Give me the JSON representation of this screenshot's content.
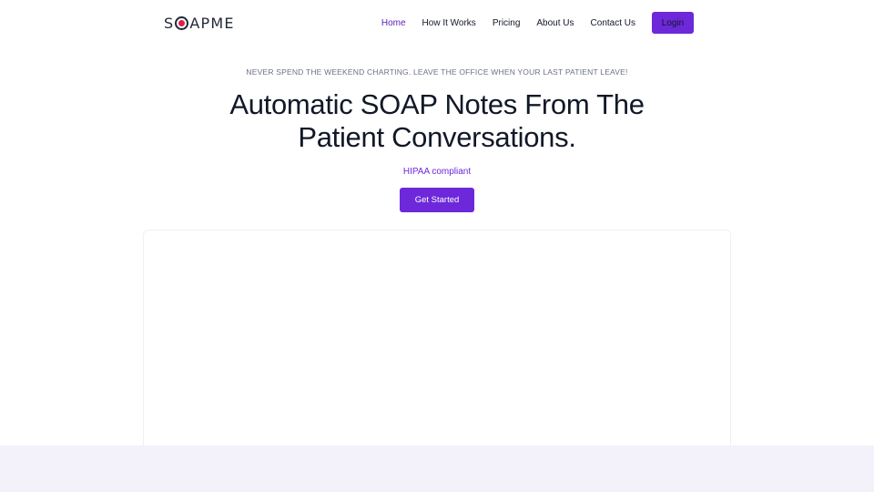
{
  "brand": {
    "name_prefix": "S",
    "name_suffix": "APME"
  },
  "nav": {
    "items": [
      {
        "label": "Home",
        "active": true
      },
      {
        "label": "How It Works"
      },
      {
        "label": "Pricing"
      },
      {
        "label": "About Us"
      },
      {
        "label": "Contact Us"
      }
    ],
    "login_label": "Login"
  },
  "hero": {
    "eyebrow": "NEVER SPEND THE WEEKEND CHARTING. LEAVE THE OFFICE WHEN YOUR LAST PATIENT LEAVE!",
    "headline_line1": "Automatic SOAP Notes From The",
    "headline_line2": "Patient Conversations.",
    "compliance": "HIPAA compliant",
    "cta_label": "Get Started"
  },
  "colors": {
    "accent": "#6d28d9",
    "logo_dot": "#e11d48",
    "footer_band": "#f3f2fb"
  }
}
